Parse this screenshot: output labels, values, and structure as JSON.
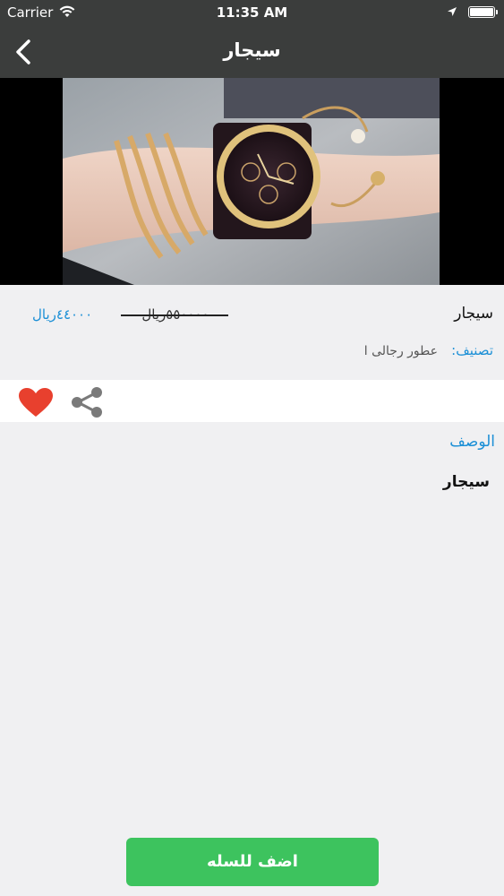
{
  "status_bar": {
    "carrier": "Carrier",
    "time": "11:35 AM"
  },
  "nav": {
    "title": "سيجار"
  },
  "product": {
    "name": "سيجار",
    "old_price": "٥٥٠٠٠٠ريال",
    "new_price": "٤٤٠٠٠ريال",
    "category_label": "تصنيف:",
    "category_value": "عطور رجالى ا"
  },
  "description": {
    "title": "الوصف",
    "body": "سيجار"
  },
  "cart": {
    "label": "اضف للسله"
  },
  "colors": {
    "bar": "#3b3d3c",
    "accent_blue": "#1b8fd6",
    "cart_green": "#3dc35e",
    "heart_red": "#e8402e",
    "share_grey": "#7a7a7a"
  },
  "icons": [
    "wifi-icon",
    "location-arrow-icon",
    "battery-icon",
    "back-chevron-icon",
    "heart-icon",
    "share-icon"
  ]
}
